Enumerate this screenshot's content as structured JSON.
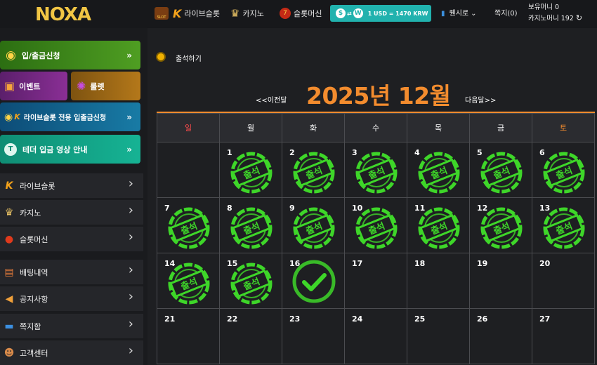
{
  "header": {
    "logo": "NOXA",
    "nav": [
      {
        "label": "라이브슬롯",
        "icon": "live-slot-icon"
      },
      {
        "label": "카지노",
        "icon": "casino-icon"
      },
      {
        "label": "슬롯머신",
        "icon": "slot-machine-icon"
      }
    ],
    "slot_badge": "SLOT",
    "exchange": {
      "coin1": "$",
      "coin2": "W",
      "rate": "1 USD = 1470 KRW",
      "color": "#21b2ae"
    },
    "language": "퀜시로",
    "notes": "쪽지(0)",
    "balance": "보유머니 0",
    "casino_money": "카지노머니 192"
  },
  "sidebar": {
    "buttons": [
      {
        "label": "입/출금신청",
        "arrow": "»"
      },
      {
        "label": "이벤트"
      },
      {
        "label": "룰렛"
      },
      {
        "label": "라이브슬롯 전용 입출금신청",
        "arrow": "»"
      },
      {
        "label": "테더 입금 영상 안내",
        "arrow": "»"
      }
    ],
    "menu": [
      {
        "label": "라이브슬롯",
        "icon": "live-slot-icon"
      },
      {
        "label": "카지노",
        "icon": "casino-icon"
      },
      {
        "label": "슬롯머신",
        "icon": "slot-machine-icon"
      },
      {
        "label": "배팅내역",
        "icon": "betting-history-icon"
      },
      {
        "label": "공지사항",
        "icon": "megaphone-icon"
      },
      {
        "label": "쪽지함",
        "icon": "message-icon"
      },
      {
        "label": "고객센터",
        "icon": "support-icon"
      }
    ]
  },
  "attendance": {
    "label": "출석하기",
    "prev": "<<이전달",
    "next": "다음달>>",
    "month_title": "2025년 12월",
    "weekdays": [
      "일",
      "월",
      "화",
      "수",
      "목",
      "금",
      "토"
    ],
    "weekday_colors": {
      "sun": "#ff4b4b",
      "sat": "#f38c2e",
      "other": "#ffffff"
    },
    "stamp_text": "출석",
    "stamp_color": "#3ed629",
    "weeks": [
      [
        null,
        1,
        2,
        3,
        4,
        5,
        6
      ],
      [
        7,
        8,
        9,
        10,
        11,
        12,
        13
      ],
      [
        14,
        15,
        16,
        17,
        18,
        19,
        20
      ],
      [
        21,
        22,
        23,
        24,
        25,
        26,
        27
      ]
    ],
    "attended_days": [
      1,
      2,
      3,
      4,
      5,
      6,
      7,
      8,
      9,
      10,
      11,
      12,
      13,
      14,
      15
    ],
    "today": 16
  }
}
